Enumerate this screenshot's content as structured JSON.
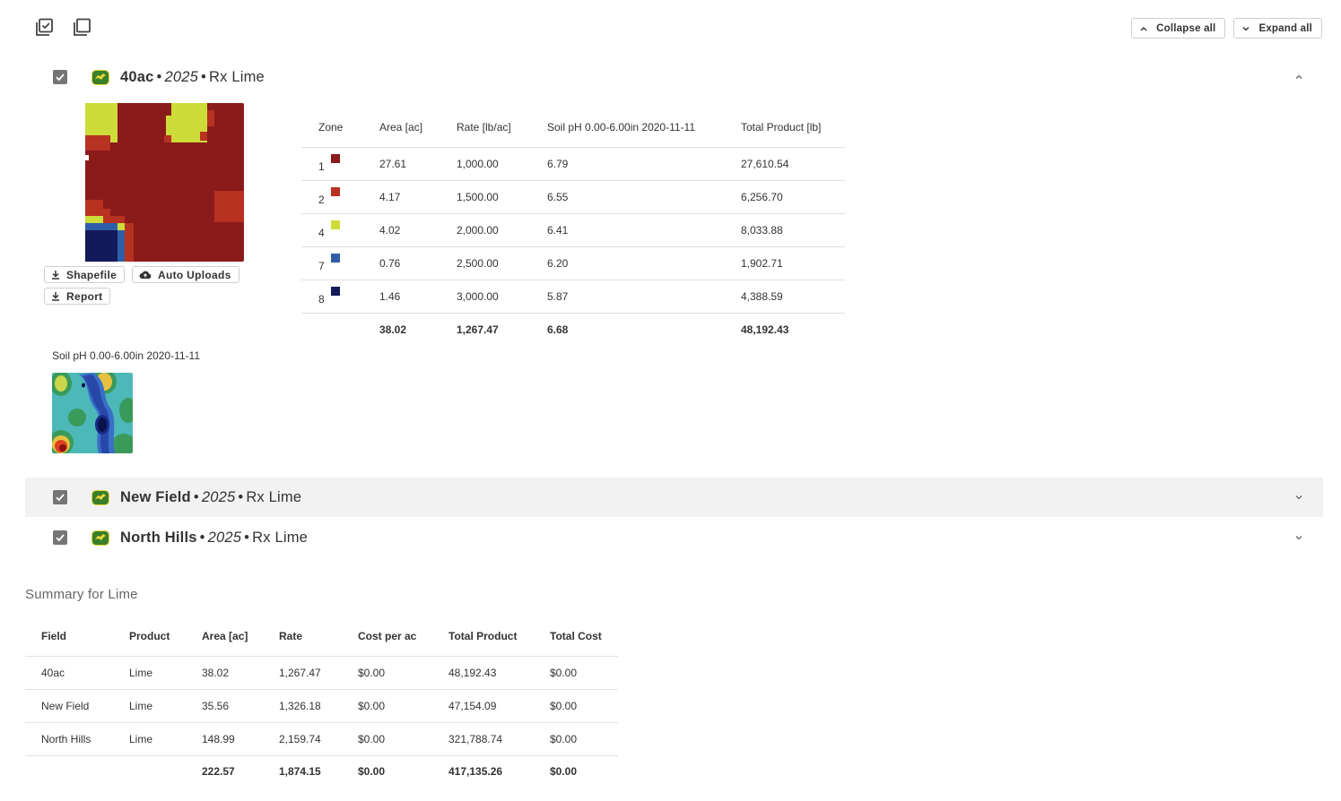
{
  "toolbar": {
    "select_all_icon": "select-all-icon",
    "copy_icon": "copy-icon",
    "collapse_all_label": "Collapse all",
    "expand_all_label": "Expand all"
  },
  "fields": [
    {
      "name": "40ac",
      "year": "2025",
      "rx": "Rx Lime",
      "checked": true,
      "expanded": true
    },
    {
      "name": "New Field",
      "year": "2025",
      "rx": "Rx Lime",
      "checked": true,
      "expanded": false
    },
    {
      "name": "North Hills",
      "year": "2025",
      "rx": "Rx Lime",
      "checked": true,
      "expanded": false
    }
  ],
  "separator": "•",
  "expanded_field": {
    "buttons": {
      "shapefile": "Shapefile",
      "auto_uploads": "Auto Uploads",
      "report": "Report"
    },
    "zone_table": {
      "headers": [
        "Zone",
        "Area [ac]",
        "Rate [lb/ac]",
        "Soil pH 0.00-6.00in 2020-11-11",
        "Total Product [lb]"
      ],
      "rows": [
        {
          "zone": "1",
          "color": "#8b1a1a",
          "area": "27.61",
          "rate": "1,000.00",
          "ph": "6.79",
          "total": "27,610.54"
        },
        {
          "zone": "2",
          "color": "#b83222",
          "area": "4.17",
          "rate": "1,500.00",
          "ph": "6.55",
          "total": "6,256.70"
        },
        {
          "zone": "4",
          "color": "#cddc39",
          "area": "4.02",
          "rate": "2,000.00",
          "ph": "6.41",
          "total": "8,033.88"
        },
        {
          "zone": "7",
          "color": "#2f5ea8",
          "area": "0.76",
          "rate": "2,500.00",
          "ph": "6.20",
          "total": "1,902.71"
        },
        {
          "zone": "8",
          "color": "#131a5a",
          "area": "1.46",
          "rate": "3,000.00",
          "ph": "5.87",
          "total": "4,388.59"
        }
      ],
      "totals": {
        "area": "38.02",
        "rate": "1,267.47",
        "ph": "6.68",
        "total": "48,192.43"
      }
    },
    "ph_layer_label": "Soil pH 0.00-6.00in 2020-11-11"
  },
  "summary": {
    "title": "Summary for Lime",
    "headers": [
      "Field",
      "Product",
      "Area [ac]",
      "Rate",
      "Cost per ac",
      "Total Product",
      "Total Cost"
    ],
    "rows": [
      [
        "40ac",
        "Lime",
        "38.02",
        "1,267.47",
        "$0.00",
        "48,192.43",
        "$0.00"
      ],
      [
        "New Field",
        "Lime",
        "35.56",
        "1,326.18",
        "$0.00",
        "47,154.09",
        "$0.00"
      ],
      [
        "North Hills",
        "Lime",
        "148.99",
        "2,159.74",
        "$0.00",
        "321,788.74",
        "$0.00"
      ]
    ],
    "totals": [
      "",
      "",
      "222.57",
      "1,874.15",
      "$0.00",
      "417,135.26",
      "$0.00"
    ]
  }
}
